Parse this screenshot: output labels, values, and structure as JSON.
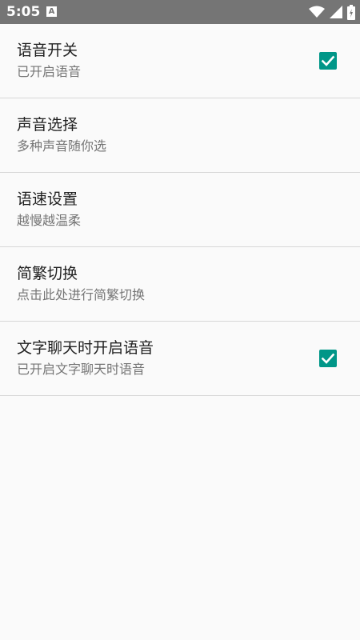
{
  "status_bar": {
    "time": "5:05",
    "notification_badge": "A",
    "icons": [
      "wifi-icon",
      "cellular-signal-icon",
      "battery-charging-icon"
    ]
  },
  "settings": {
    "items": [
      {
        "title": "语音开关",
        "summary": "已开启语音",
        "checked": true
      },
      {
        "title": "声音选择",
        "summary": "多种声音随你选"
      },
      {
        "title": "语速设置",
        "summary": "越慢越温柔"
      },
      {
        "title": "简繁切换",
        "summary": "点击此处进行简繁切换"
      },
      {
        "title": "文字聊天时开启语音",
        "summary": "已开启文字聊天时语音",
        "checked": true
      }
    ]
  },
  "colors": {
    "accent": "#009688",
    "status_bar": "#757575",
    "background": "#fafafa",
    "title_text": "#212121",
    "summary_text": "#757575",
    "divider": "#d6d6d6"
  }
}
